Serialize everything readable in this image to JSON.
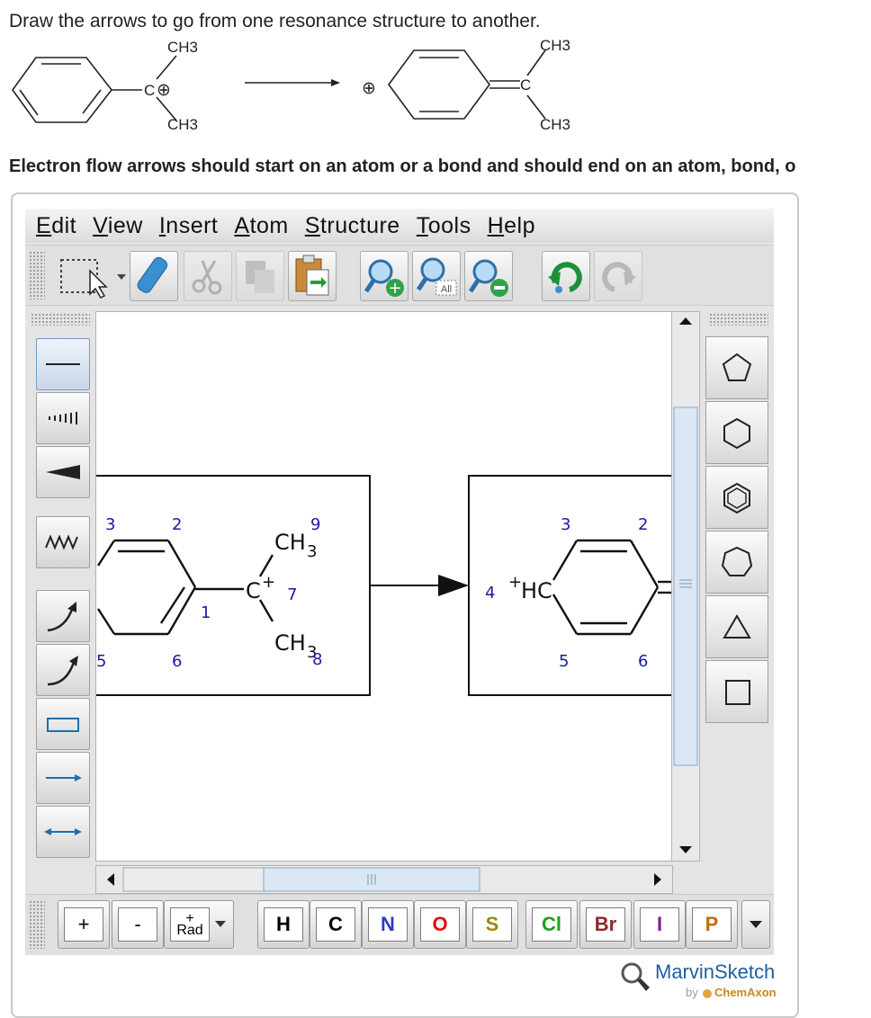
{
  "question": {
    "prompt": "Draw the arrows to go from one resonance structure to another.",
    "instruction": "Electron flow arrows should start on an atom or a bond and should end on an atom, bond, o",
    "reactant": {
      "top_group": "CH3",
      "bottom_group": "CH3",
      "charge": "⊕"
    },
    "product": {
      "top_group": "CH3",
      "bottom_group": "CH3",
      "ring_charge": "⊕",
      "center_atom": "C"
    }
  },
  "editor": {
    "menu": [
      {
        "pre": "",
        "ul": "E",
        "post": "dit"
      },
      {
        "pre": "",
        "ul": "V",
        "post": "iew"
      },
      {
        "pre": "",
        "ul": "I",
        "post": "nsert"
      },
      {
        "pre": "",
        "ul": "A",
        "post": "tom"
      },
      {
        "pre": "",
        "ul": "S",
        "post": "tructure"
      },
      {
        "pre": "",
        "ul": "T",
        "post": "ools"
      },
      {
        "pre": "",
        "ul": "H",
        "post": "elp"
      }
    ],
    "toolbar": {
      "select_icon": "rectangle-select-icon",
      "erase_icon": "eraser-icon",
      "cut_icon": "scissors-icon",
      "copy_icon": "copy-icon",
      "paste_icon": "paste-icon",
      "zoom_in_icon": "zoom-in-icon",
      "zoom_all_label": "All",
      "zoom_out_icon": "zoom-out-icon",
      "undo_icon": "undo-icon",
      "redo_icon": "redo-icon"
    },
    "canvas": {
      "left_molecule": {
        "labels": {
          "n3": "3",
          "n2": "2",
          "n9": "9",
          "n7": "7",
          "n1": "1",
          "n5": "5",
          "n6": "6",
          "n8": "8"
        },
        "ch3_top": "CH",
        "ch3_top_sub": "3",
        "cation": "C",
        "cation_charge": "+",
        "ch3_bottom": "CH",
        "ch3_bottom_sub": "3"
      },
      "right_molecule": {
        "labels": {
          "n3": "3",
          "n2": "2",
          "n4": "4",
          "n5": "5",
          "n6": "6"
        },
        "hc_charge": "+",
        "hc": "HC"
      }
    },
    "elements": {
      "plus": "+",
      "minus": "-",
      "rad_charge": "+",
      "rad": "Rad",
      "atoms": [
        {
          "symbol": "H",
          "color": "#222222"
        },
        {
          "symbol": "C",
          "color": "#222222"
        },
        {
          "symbol": "N",
          "color": "#2a3dbf"
        },
        {
          "symbol": "O",
          "color": "#e01010"
        },
        {
          "symbol": "S",
          "color": "#9b8a10"
        },
        {
          "symbol": "Cl",
          "color": "#1aa11a"
        },
        {
          "symbol": "Br",
          "color": "#8a2a2a"
        },
        {
          "symbol": "I",
          "color": "#7a1f9a"
        },
        {
          "symbol": "P",
          "color": "#c46a10"
        }
      ]
    },
    "brand": {
      "name": "MarvinSketch",
      "by": "by",
      "company": "ChemAxon"
    }
  }
}
